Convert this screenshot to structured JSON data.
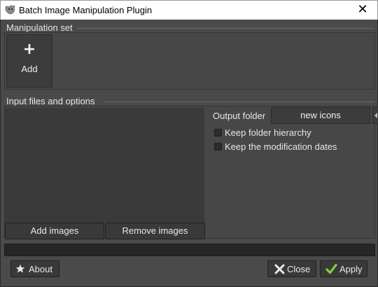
{
  "window": {
    "title": "Batch Image Manipulation Plugin",
    "close_symbol": "✕"
  },
  "manipulation_set": {
    "label": "Manipulation set",
    "add_tile": {
      "icon": "+",
      "label": "Add"
    }
  },
  "input_section": {
    "label": "Input files and options",
    "add_images_label": "Add images",
    "remove_images_label": "Remove images",
    "files": []
  },
  "output": {
    "label": "Output folder",
    "folder_value": "new icons",
    "options": [
      {
        "label": "Keep folder hierarchy",
        "checked": false
      },
      {
        "label": "Keep the modification dates",
        "checked": false
      }
    ]
  },
  "progress": {
    "value": 0
  },
  "footer": {
    "about_label": "About",
    "close_label": "Close",
    "apply_label": "Apply"
  },
  "colors": {
    "background": "#4a4a4a",
    "apply_check": "#7dd23f"
  }
}
